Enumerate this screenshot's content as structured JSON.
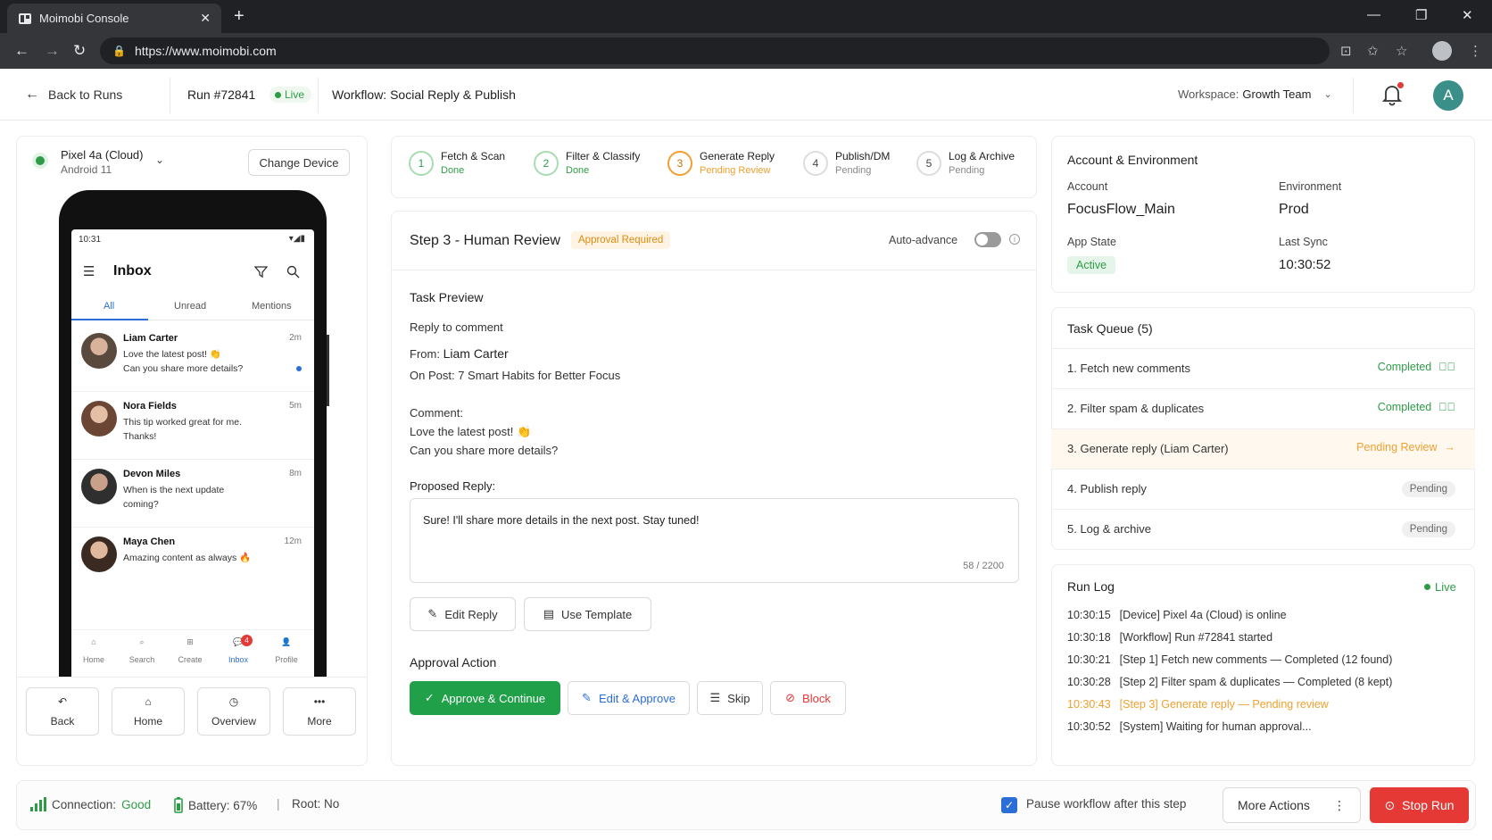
{
  "browser": {
    "tab_title": "Moimobi Console",
    "url": "https://www.moimobi.com"
  },
  "header": {
    "back_label": "Back to Runs",
    "run_id": "Run #72841",
    "live_label": "Live",
    "workflow": "Workflow: Social Reply & Publish",
    "workspace_label": "Workspace:",
    "workspace_value": "Growth Team",
    "avatar_initial": "A"
  },
  "device": {
    "name": "Pixel 4a (Cloud)",
    "os": "Android 11",
    "change_label": "Change Device",
    "phone": {
      "time": "10:31",
      "title": "Inbox",
      "tabs": [
        "All",
        "Unread",
        "Mentions"
      ],
      "messages": [
        {
          "name": "Liam Carter",
          "time": "2m",
          "l1": "Love the latest post! 👏",
          "l2": "Can you share more details?"
        },
        {
          "name": "Nora Fields",
          "time": "5m",
          "l1": "This tip worked great for me.",
          "l2": "Thanks!"
        },
        {
          "name": "Devon Miles",
          "time": "8m",
          "l1": "When is the next update",
          "l2": "coming?"
        },
        {
          "name": "Maya Chen",
          "time": "12m",
          "l1": "Amazing content as always 🔥",
          "l2": ""
        }
      ],
      "nav": [
        "Home",
        "Search",
        "Create",
        "Inbox",
        "Profile"
      ],
      "inbox_badge": "4"
    },
    "buttons": [
      "Back",
      "Home",
      "Overview",
      "More"
    ]
  },
  "steps": [
    {
      "num": "1",
      "label": "Fetch & Scan",
      "status": "Done"
    },
    {
      "num": "2",
      "label": "Filter & Classify",
      "status": "Done"
    },
    {
      "num": "3",
      "label": "Generate Reply",
      "status": "Pending Review"
    },
    {
      "num": "4",
      "label": "Publish/DM",
      "status": "Pending"
    },
    {
      "num": "5",
      "label": "Log & Archive",
      "status": "Pending"
    }
  ],
  "review": {
    "title": "Step 3 - Human Review",
    "badge": "Approval Required",
    "auto_advance": "Auto-advance",
    "task_preview": "Task Preview",
    "reply_to": "Reply to comment",
    "from_label": "From:",
    "from_value": "Liam Carter",
    "on_post": "On Post: 7 Smart Habits for Better Focus",
    "comment_label": "Comment:",
    "comment_l1": "Love the latest post! 👏",
    "comment_l2": "Can you share more details?",
    "proposed_label": "Proposed Reply:",
    "proposed_text": "Sure! I'll share more details in the next post. Stay tuned!",
    "char_count": "58 / 2200",
    "edit_reply": "Edit Reply",
    "use_template": "Use Template",
    "approval_action": "Approval Action",
    "approve": "Approve & Continue",
    "edit_approve": "Edit & Approve",
    "skip": "Skip",
    "block": "Block"
  },
  "account": {
    "title": "Account & Environment",
    "account_label": "Account",
    "account_value": "FocusFlow_Main",
    "env_label": "Environment",
    "env_value": "Prod",
    "state_label": "App State",
    "state_value": "Active",
    "sync_label": "Last Sync",
    "sync_value": "10:30:52"
  },
  "queue": {
    "title": "Task Queue (5)",
    "items": [
      {
        "label": "1.  Fetch new comments",
        "status": "Completed"
      },
      {
        "label": "2.  Filter spam & duplicates",
        "status": "Completed"
      },
      {
        "label": "3.  Generate reply (Liam Carter)",
        "status": "Pending Review"
      },
      {
        "label": "4.  Publish reply",
        "status": "Pending"
      },
      {
        "label": "5.  Log & archive",
        "status": "Pending"
      }
    ]
  },
  "runlog": {
    "title": "Run Log",
    "live": "Live",
    "entries": [
      {
        "time": "10:30:15",
        "text": "[Device] Pixel 4a (Cloud) is online"
      },
      {
        "time": "10:30:18",
        "text": "[Workflow] Run #72841 started"
      },
      {
        "time": "10:30:21",
        "text": "[Step 1] Fetch new comments — Completed (12 found)"
      },
      {
        "time": "10:30:28",
        "text": "[Step 2] Filter spam & duplicates — Completed (8 kept)"
      },
      {
        "time": "10:30:43",
        "text": "[Step 3] Generate reply — Pending review"
      },
      {
        "time": "10:30:52",
        "text": "[System] Waiting for human approval..."
      }
    ]
  },
  "footer": {
    "conn_label": "Connection:",
    "conn_value": "Good",
    "battery": "Battery: 67%",
    "sep": "|",
    "root": "Root: No",
    "pause": "Pause workflow after this step",
    "more_actions": "More Actions",
    "stop": "Stop Run"
  }
}
